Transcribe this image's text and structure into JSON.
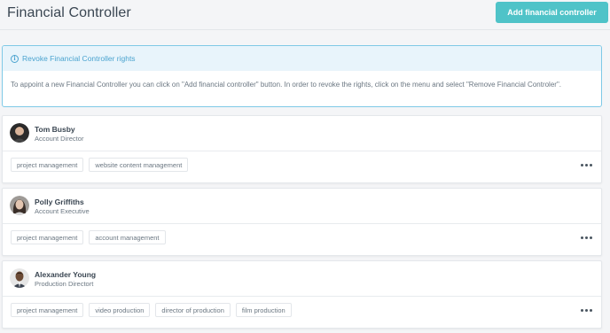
{
  "page": {
    "title": "Financial Controller",
    "add_button_label": "Add financial controller"
  },
  "info": {
    "icon": "info-icon",
    "icon_glyph": "i",
    "heading": "Revoke Financial Controller rights",
    "body": "To appoint a new Financial Controller you can click on \"Add financial controller\" button. In order to revoke the rights, click on the menu and select \"Remove Financial Controler\"."
  },
  "controllers": [
    {
      "name": "Tom Busby",
      "role": "Account Director",
      "avatar": "man-dark-hair",
      "tags": [
        "project management",
        "website content management"
      ]
    },
    {
      "name": "Polly Griffiths",
      "role": "Account Executive",
      "avatar": "woman-long-hair",
      "tags": [
        "project management",
        "account management"
      ]
    },
    {
      "name": "Alexander Young",
      "role": "Production Directort",
      "avatar": "man-suit",
      "tags": [
        "project management",
        "video production",
        "director of production",
        "film production"
      ]
    }
  ],
  "colors": {
    "accent": "#4fc3c8",
    "info": "#4aa3cf",
    "info_bg": "#e8f4fb"
  }
}
